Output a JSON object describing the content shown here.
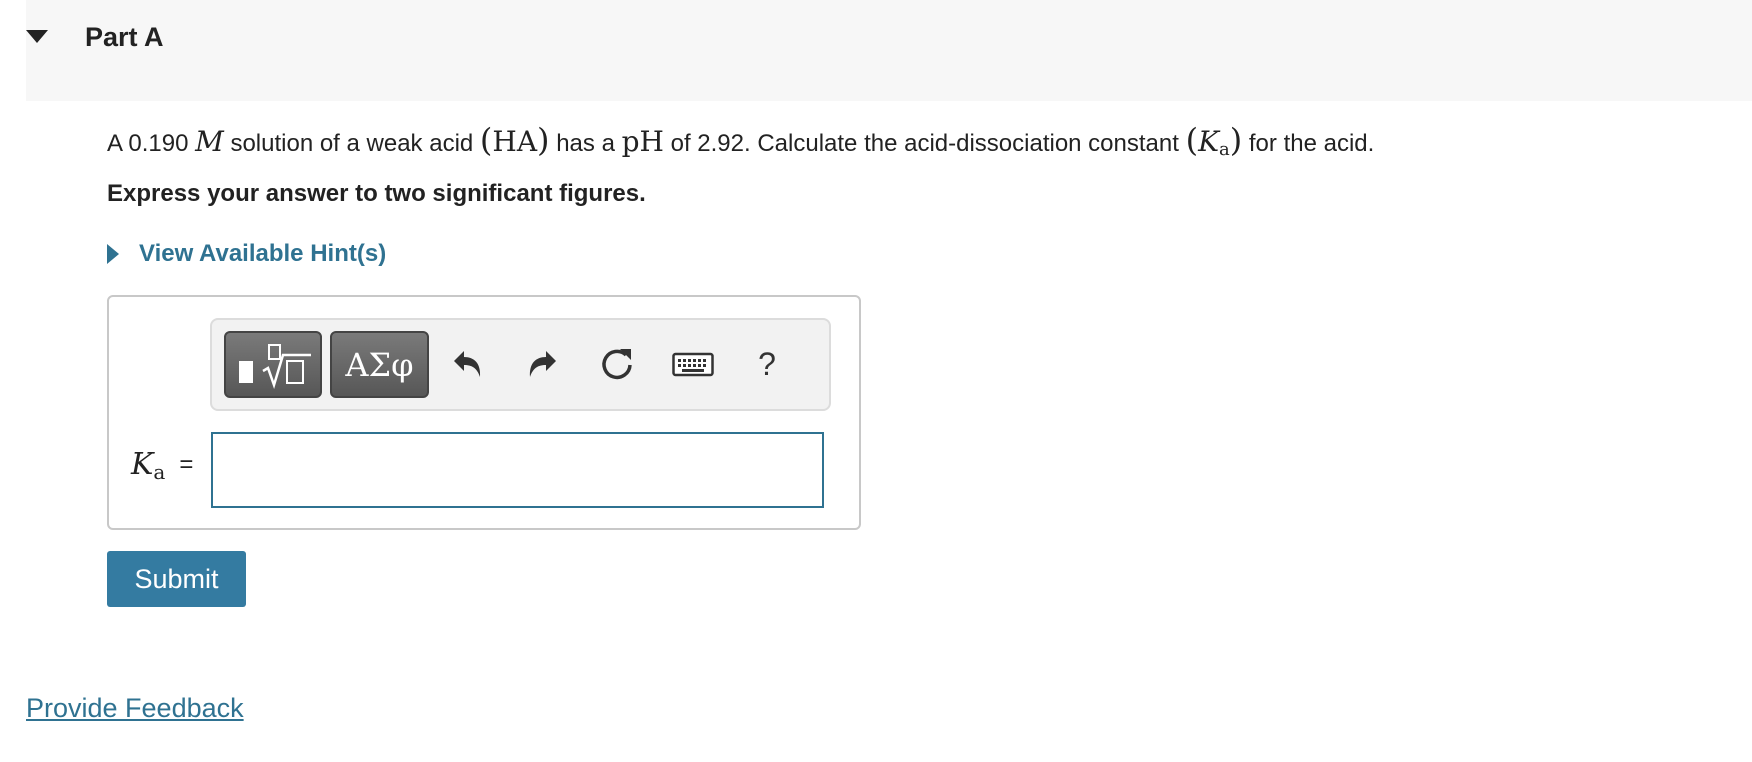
{
  "part": {
    "title": "Part A"
  },
  "question": {
    "text_1": "A 0.190",
    "unit_M": "M",
    "text_2": "solution of a weak acid",
    "formula_open": "(",
    "formula_HA": "HA",
    "formula_close": ")",
    "text_3": "has a",
    "pH_symbol": "pH",
    "text_4": "of 2.92. Calculate the acid-dissociation constant",
    "ka_open": "(",
    "ka_K": "K",
    "ka_sub": "a",
    "ka_close": ")",
    "text_5": "for the acid."
  },
  "instruction": "Express your answer to two significant figures.",
  "hints": {
    "label": "View Available Hint(s)"
  },
  "toolbar": {
    "templates_icon": "templates-sqrt-icon",
    "greek_label": "ΑΣφ",
    "undo_icon": "undo-icon",
    "redo_icon": "redo-icon",
    "reset_icon": "reset-icon",
    "keyboard_icon": "keyboard-icon",
    "help_label": "?"
  },
  "answer": {
    "var_K": "K",
    "var_sub": "a",
    "equals": "=",
    "value": ""
  },
  "submit_label": "Submit",
  "feedback_label": "Provide Feedback",
  "colors": {
    "link": "#2f7291",
    "submit": "#347ba1",
    "header_bg": "#f7f7f7",
    "input_border": "#2f7291"
  }
}
